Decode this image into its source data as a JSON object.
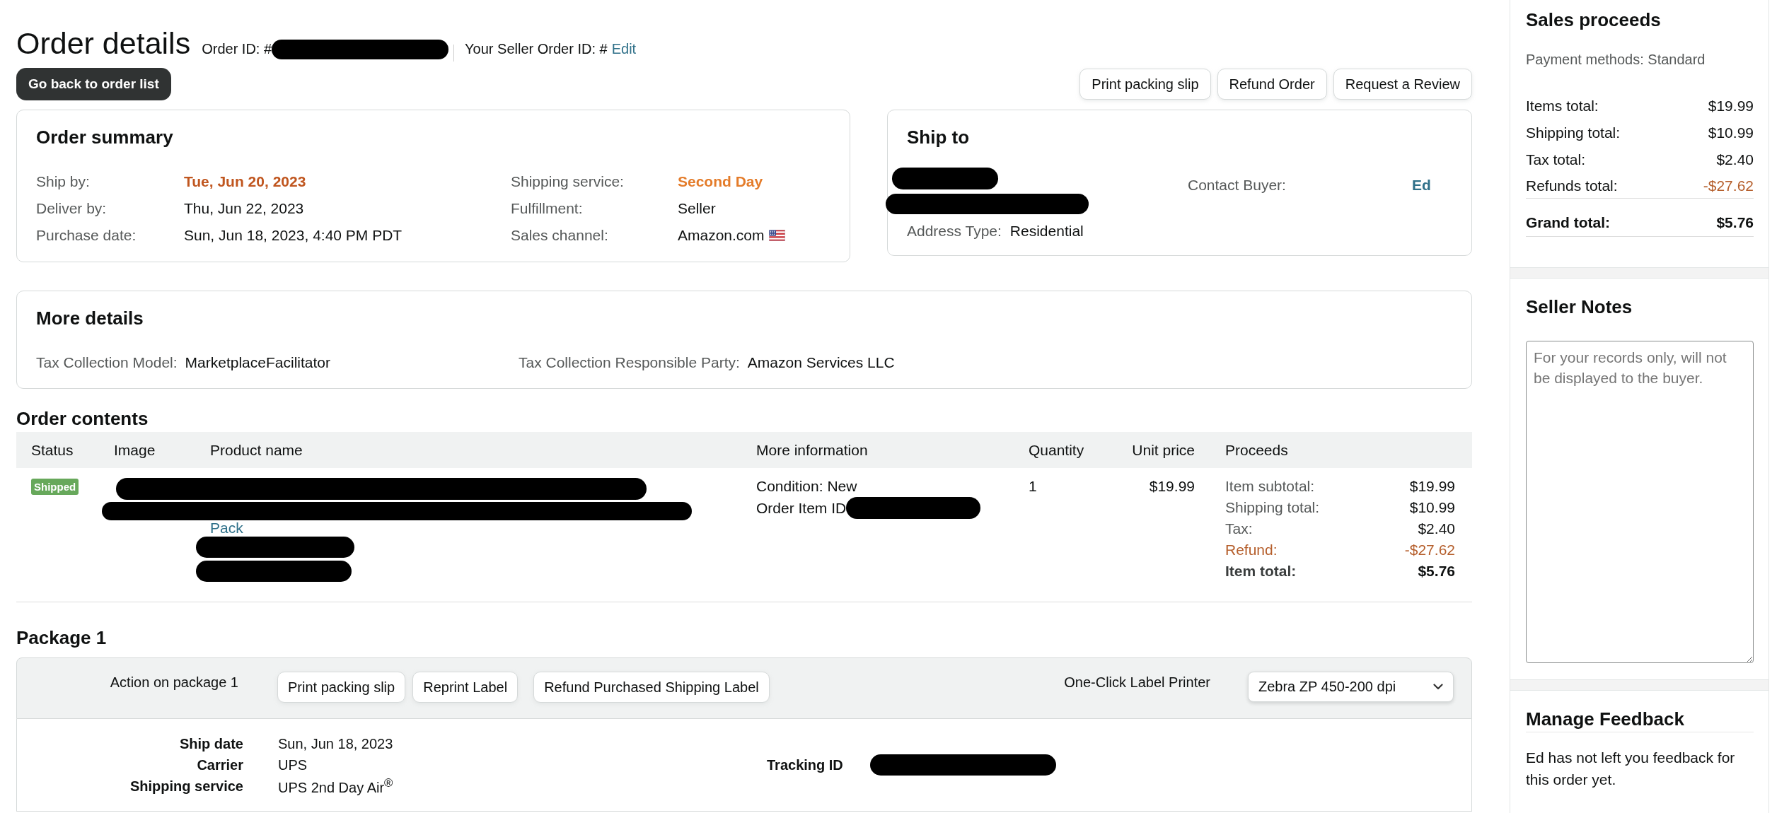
{
  "header": {
    "title": "Order details",
    "order_id_label": "Order ID: #",
    "seller_order_id_label": "Your Seller Order ID: #",
    "edit_link": "Edit",
    "back_button": "Go back to order list"
  },
  "actions": [
    "Print packing slip",
    "Refund Order",
    "Request a Review"
  ],
  "order_summary": {
    "title": "Order summary",
    "columns": [
      {
        "fields": [
          {
            "label": "Ship by:",
            "value": "Tue, Jun 20, 2023",
            "highlighted": true,
            "color": "#c0561f",
            "kind": "text"
          },
          {
            "label": "Deliver by:",
            "value": "Thu, Jun 22, 2023",
            "highlighted": false,
            "kind": "text"
          },
          {
            "label": "Purchase date:",
            "value": "Sun, Jun 18, 2023, 4:40 PM PDT",
            "highlighted": false,
            "kind": "text"
          }
        ]
      },
      {
        "fields": [
          {
            "label": "Shipping service:",
            "value": "Second Day",
            "highlighted": true,
            "color": "#e47c2a",
            "kind": "text"
          },
          {
            "label": "Fulfillment:",
            "value": "Seller",
            "highlighted": false,
            "kind": "text"
          },
          {
            "label": "Sales channel:",
            "value": "Amazon.com",
            "highlighted": false,
            "kind": "marketplace"
          }
        ]
      }
    ]
  },
  "ship_to": {
    "title": "Ship to",
    "address_type_label": "Address Type:",
    "address_type": "Residential",
    "contact_label": "Contact Buyer:",
    "buyer_name": "Ed"
  },
  "more_details": {
    "title": "More details",
    "fields": [
      {
        "label": "Tax Collection Model:",
        "value": "MarketplaceFacilitator"
      },
      {
        "label": "Tax Collection Responsible Party:",
        "value": "Amazon Services LLC"
      }
    ]
  },
  "order_contents": {
    "title": "Order contents",
    "columns": [
      "Status",
      "Image",
      "Product name",
      "More information",
      "Quantity",
      "Unit price",
      "Proceeds"
    ],
    "rows": [
      {
        "status": "Shipped",
        "product_name": "Pack",
        "condition": "Condition: New",
        "order_item_id_label": "Order Item ID",
        "quantity": "1",
        "unit_price": "$19.99",
        "proceeds": [
          {
            "label": "Item subtotal:",
            "value": "$19.99",
            "kind": "amount"
          },
          {
            "label": "Shipping total:",
            "value": "$10.99",
            "kind": "amount"
          },
          {
            "label": "Tax:",
            "value": "$2.40",
            "kind": "amount"
          },
          {
            "label": "Refund:",
            "value": "-$27.62",
            "kind": "refund"
          },
          {
            "label": "Item total:",
            "value": "$5.76",
            "kind": "total"
          }
        ]
      }
    ]
  },
  "package": {
    "title": "Package 1",
    "action_label": "Action on package 1",
    "buttons": [
      "Print packing slip",
      "Reprint Label",
      "Refund Purchased Shipping Label"
    ],
    "printer_label": "One-Click Label Printer",
    "printer": "Zebra ZP 450-200 dpi",
    "details": [
      {
        "label": "Ship date",
        "value": "Sun, Jun 18, 2023"
      },
      {
        "label": "Carrier",
        "value": "UPS"
      },
      {
        "label": "Shipping service",
        "value": "UPS 2nd Day Air$^{®}$"
      }
    ],
    "tracking_label": "Tracking ID"
  },
  "sales_proceeds": {
    "title": "Sales proceeds",
    "payment_methods": "Payment methods: Standard",
    "lines": [
      {
        "label": "Items total:",
        "value": "$19.99",
        "kind": "amount"
      },
      {
        "label": "Shipping total:",
        "value": "$10.99",
        "kind": "amount"
      },
      {
        "label": "Tax total:",
        "value": "$2.40",
        "kind": "amount"
      },
      {
        "label": "Refunds total:",
        "value": "-$27.62",
        "kind": "refund"
      }
    ],
    "grand_total": {
      "label": "Grand total:",
      "value": "$5.76"
    }
  },
  "seller_notes": {
    "title": "Seller Notes",
    "placeholder": "For your records only, will not be displayed to the buyer."
  },
  "feedback": {
    "title": "Manage Feedback",
    "text": "Ed has not left you feedback for this order yet."
  }
}
